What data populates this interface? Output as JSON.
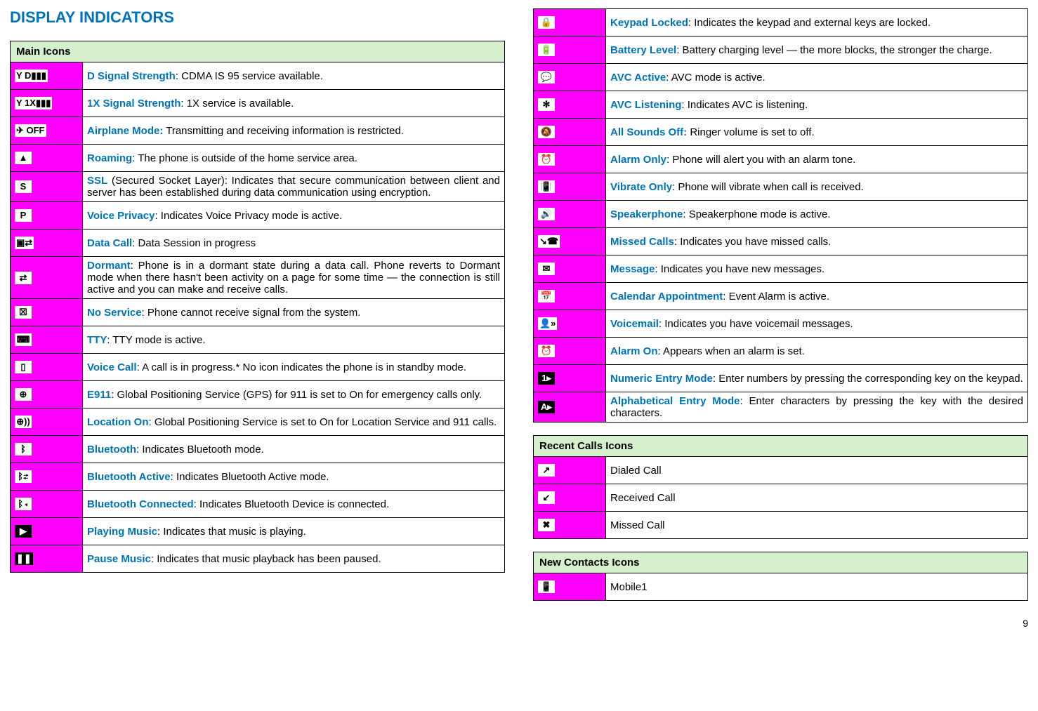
{
  "title": "DISPLAY INDICATORS",
  "pageNumber": "9",
  "tables": {
    "main": {
      "header": "Main Icons",
      "rows": [
        {
          "glyph": "Y D▮▮▮",
          "term": "D Signal Strength",
          "desc": ": CDMA IS 95 service available."
        },
        {
          "glyph": "Y 1X▮▮▮",
          "term": "1X Signal Strength",
          "desc": ": 1X service is available."
        },
        {
          "glyph": "✈ OFF",
          "term": "Airplane Mode:",
          "desc": " Transmitting and receiving information is restricted."
        },
        {
          "glyph": "▲",
          "term": "Roaming",
          "desc": ": The phone is outside of the home service area."
        },
        {
          "glyph": "S",
          "term": "SSL",
          "desc": " (Secured Socket Layer): Indicates that secure communication between client and server has been established during data communication using encryption."
        },
        {
          "glyph": "P",
          "term": "Voice Privacy",
          "desc": ": Indicates Voice Privacy mode is active."
        },
        {
          "glyph": "▣⇄",
          "term": "Data Call",
          "desc": ": Data Session in progress"
        },
        {
          "glyph": "⇄",
          "term": "Dormant",
          "desc": ": Phone is in a dormant state during a data call. Phone reverts to Dormant mode when there hasn't been activity on a page for some time — the connection is still active and you can make and receive calls."
        },
        {
          "glyph": "☒",
          "term": "No Service",
          "desc": ": Phone cannot receive signal from the system."
        },
        {
          "glyph": "⌨",
          "term": "TTY",
          "desc": ": TTY mode is active."
        },
        {
          "glyph": "▯",
          "term": "Voice Call",
          "desc": ": A call is in progress.* No icon indicates the phone is in standby mode."
        },
        {
          "glyph": "⊕",
          "term": "E911",
          "desc": ": Global Positioning Service (GPS) for 911 is set to On for emergency calls only."
        },
        {
          "glyph": "⊕))",
          "term": "Location On",
          "desc": ": Global Positioning Service is set to On for Location Service and 911 calls."
        },
        {
          "glyph": "ᛒ",
          "term": "Bluetooth",
          "desc": ": Indicates Bluetooth mode."
        },
        {
          "glyph": "ᛒ⇄",
          "term": "Bluetooth Active",
          "desc": ": Indicates Bluetooth Active mode."
        },
        {
          "glyph": "ᛒ◂",
          "term": "Bluetooth Connected",
          "desc": ": Indicates Bluetooth Device is connected."
        },
        {
          "glyph": "▶",
          "gclass": "black",
          "term": "Playing Music",
          "desc": ": Indicates that music is playing."
        },
        {
          "glyph": "❚❚",
          "gclass": "black",
          "term": "Pause Music",
          "desc": ": Indicates that music playback has been paused."
        }
      ]
    },
    "main2": {
      "rows": [
        {
          "glyph": "🔒",
          "term": "Keypad Locked",
          "desc": ": Indicates the keypad and external keys are locked."
        },
        {
          "glyph": "🔋",
          "term": "Battery Level",
          "desc": ": Battery charging level — the more blocks, the stronger the charge."
        },
        {
          "glyph": "💬",
          "term": "AVC Active",
          "desc": ": AVC mode is active."
        },
        {
          "glyph": "✻",
          "term": "AVC Listening",
          "desc": ": Indicates AVC is listening."
        },
        {
          "glyph": "🔕",
          "term": "All Sounds Off:",
          "desc": " Ringer volume is set to off."
        },
        {
          "glyph": "⏰",
          "term": "Alarm Only",
          "desc": ": Phone will alert you with an alarm tone."
        },
        {
          "glyph": "📳",
          "term": "Vibrate Only",
          "desc": ": Phone will vibrate when call is received."
        },
        {
          "glyph": "🔊",
          "term": "Speakerphone",
          "desc": ": Speakerphone mode is active."
        },
        {
          "glyph": "↘☎",
          "term": "Missed Calls",
          "desc": ": Indicates you have missed calls."
        },
        {
          "glyph": "✉",
          "term": "Message",
          "desc": ": Indicates you have new messages."
        },
        {
          "glyph": "📅",
          "term": "Calendar Appointment",
          "desc": ": Event Alarm is active."
        },
        {
          "glyph": "👤»",
          "term": "Voicemail",
          "desc": ": Indicates you have voicemail messages."
        },
        {
          "glyph": "⏰",
          "term": "Alarm On",
          "desc": ": Appears when an alarm is set."
        },
        {
          "glyph": "1▸",
          "gclass": "black",
          "term": "Numeric Entry Mode",
          "desc": ": Enter numbers by pressing the corresponding key on the keypad."
        },
        {
          "glyph": "A▸",
          "gclass": "black",
          "term": "Alphabetical Entry Mode",
          "desc": ": Enter characters by pressing the key with the desired characters."
        }
      ]
    },
    "recent": {
      "header": "Recent Calls Icons",
      "rows": [
        {
          "glyph": "↗",
          "desc": "Dialed Call"
        },
        {
          "glyph": "↙",
          "desc": "Received Call"
        },
        {
          "glyph": "✖",
          "desc": "Missed Call"
        }
      ]
    },
    "contacts": {
      "header": "New Contacts Icons",
      "rows": [
        {
          "glyph": "📱",
          "desc": "Mobile1"
        }
      ]
    }
  }
}
